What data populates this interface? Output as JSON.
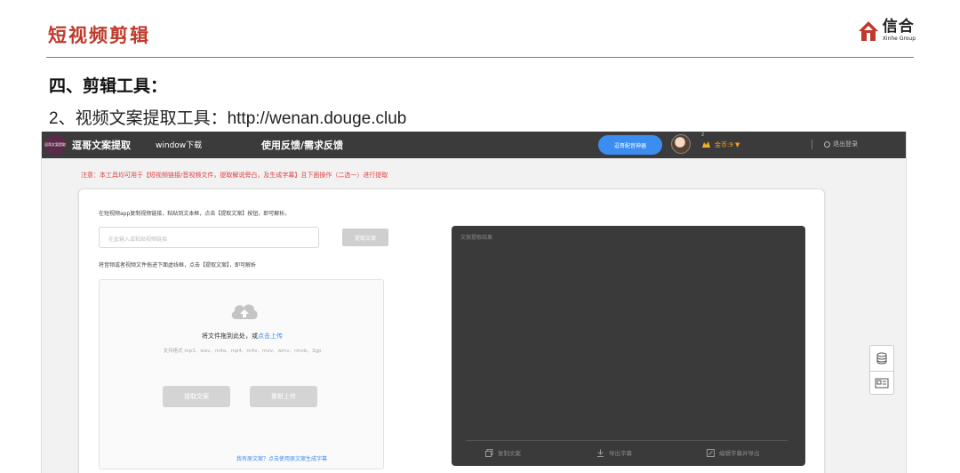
{
  "slide": {
    "title": "短视频剪辑",
    "logo_cn": "信合",
    "logo_en": "Xinhe Group",
    "heading": "四、剪辑工具：",
    "subheading": "2、视频文案提取工具：http://wenan.douge.club"
  },
  "app": {
    "brand_badge": "逗哥文案提取",
    "brand_name": "逗哥文案提取",
    "nav_download": "window下载",
    "nav_feedback": "使用反馈/需求反馈",
    "config_button": "逗哥配音神器",
    "avatar_badge": "2",
    "coins": "金币:9 ▼",
    "logout": "退出登录",
    "notice": "注意：本工具均可用于【短视频链接/音视频文件，提取解说旁白，及生成字幕】且下面操作（二选一）进行提取",
    "instruction_link": "在短视频app复制视频链接，粘贴到文本框，点击【提取文案】按钮，即可解析。",
    "url_placeholder": "在此输入或粘贴视频链接",
    "extract_button": "提取文案",
    "instruction_file": "将音频或者视频文件拖进下面虚线框，点击【提取文案】，即可解析",
    "drop_text": "将文件拖到此处，或",
    "drop_link": "点击上传",
    "formats": "支持格式 mp3、wav、m4a、mp4、m4v、mov、wmv、rmvb、3gp",
    "extract_button_2": "提取文案",
    "reupload_button": "重新上传",
    "hint_link": "我有原文案？点击使用原文案生成字幕",
    "result_label": "文案提取结果",
    "copy_action": "复制文案",
    "export_subtitle": "导出字幕",
    "edit_export": "编辑字幕并导出"
  },
  "colors": {
    "title_red": "#c0392b",
    "topbar": "#3b3b3b",
    "accent_blue": "#3c8df0",
    "notice_red": "#e04040",
    "result_panel": "#3a3a3a"
  },
  "icons": [
    "xinhe-logo-icon",
    "user-avatar",
    "coin-icon",
    "logout-icon",
    "cloud-upload-icon",
    "copy-icon",
    "download-icon",
    "edit-icon",
    "coins-stack-icon",
    "id-card-icon"
  ]
}
